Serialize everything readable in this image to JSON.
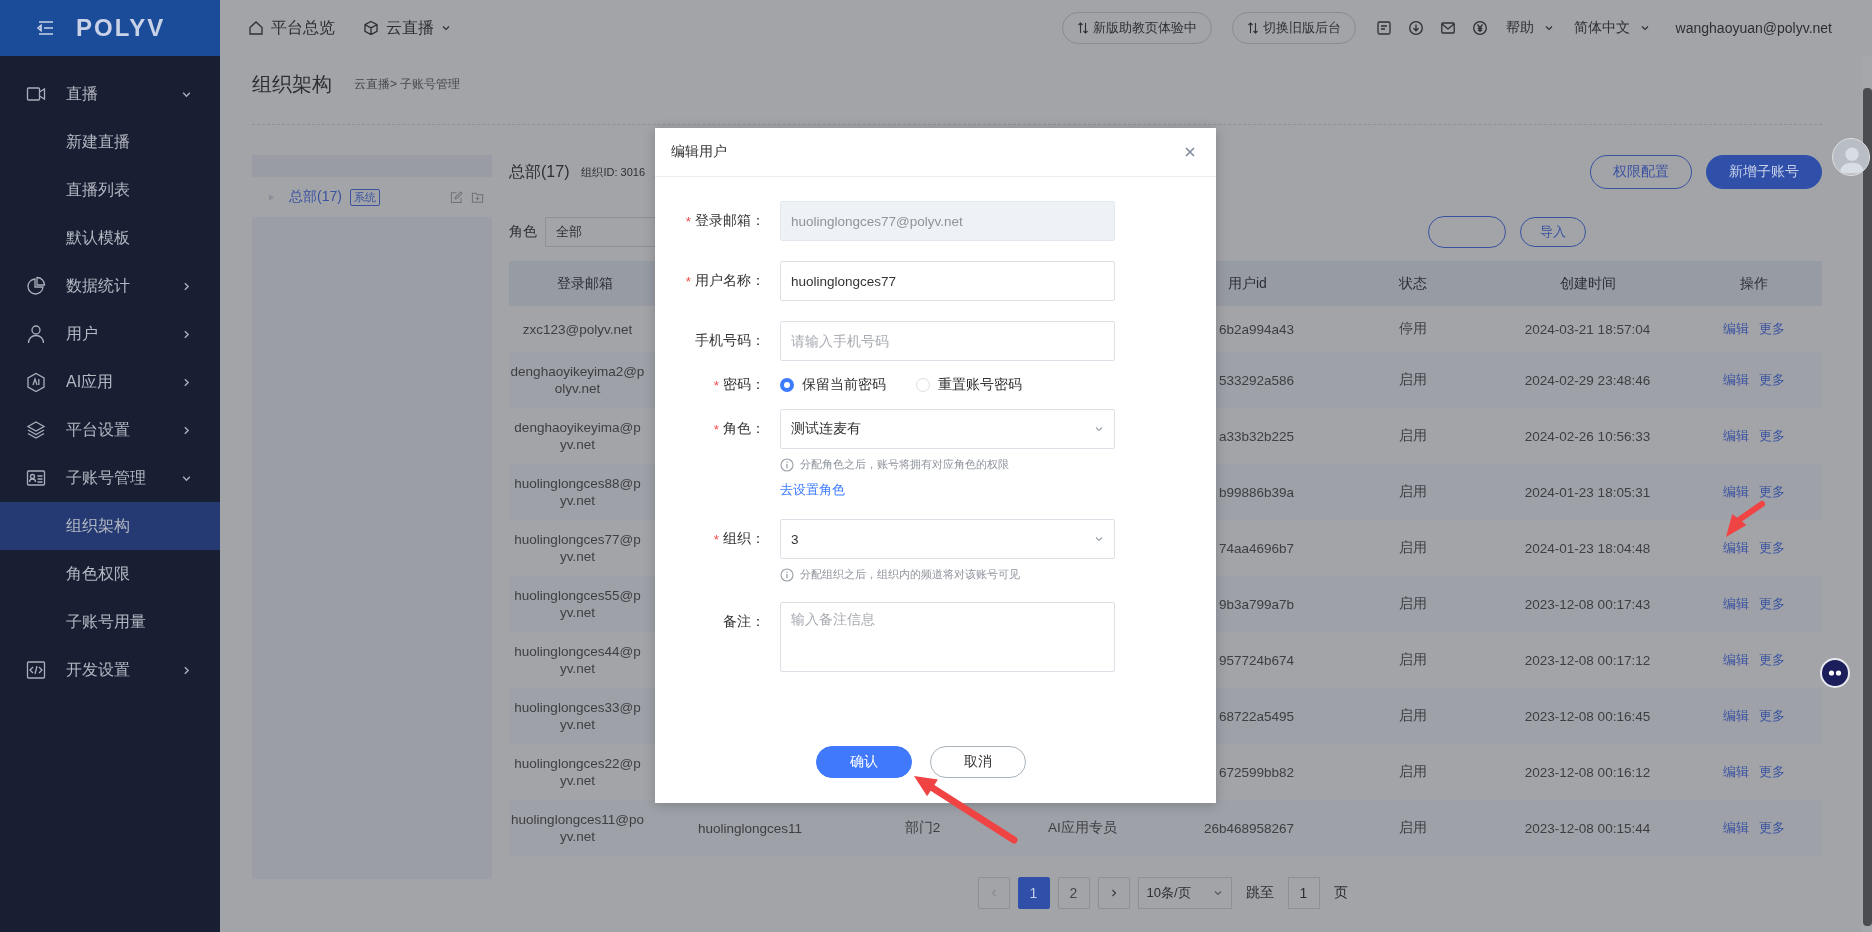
{
  "sidebar": {
    "logo": "POLYV",
    "items": [
      {
        "label": "直播",
        "expanded": true,
        "children": [
          {
            "label": "新建直播",
            "selected": false
          },
          {
            "label": "直播列表",
            "selected": false
          },
          {
            "label": "默认模板",
            "selected": false
          }
        ]
      },
      {
        "label": "数据统计",
        "expanded": false
      },
      {
        "label": "用户",
        "expanded": false
      },
      {
        "label": "AI应用",
        "expanded": false
      },
      {
        "label": "平台设置",
        "expanded": false
      },
      {
        "label": "子账号管理",
        "expanded": true,
        "children": [
          {
            "label": "组织架构",
            "selected": true
          },
          {
            "label": "角色权限",
            "selected": false
          },
          {
            "label": "子账号用量",
            "selected": false
          }
        ]
      },
      {
        "label": "开发设置",
        "expanded": false
      }
    ]
  },
  "topbar": {
    "nav": [
      {
        "label": "平台总览",
        "dropdown": false
      },
      {
        "label": "云直播",
        "dropdown": true
      }
    ],
    "buttons": [
      "新版助教页体验中",
      "切换旧版后台"
    ],
    "menus": [
      {
        "label": "帮助"
      },
      {
        "label": "简体中文"
      }
    ],
    "user": "wanghaoyuan@polyv.net"
  },
  "page": {
    "title": "组织架构",
    "breadcrumb": "云直播> 子账号管理"
  },
  "org_tree": {
    "items": [
      {
        "label": "总部(17)",
        "tag": "系统",
        "selected": true
      }
    ]
  },
  "panel": {
    "title": "总部(17)",
    "org_id": "组织ID: 3016",
    "buttons": [
      {
        "label": "权限配置",
        "primary": false
      },
      {
        "label": "新增子账号",
        "primary": true
      }
    ],
    "filter": {
      "label": "角色",
      "value": "全部"
    },
    "import": "导入"
  },
  "table": {
    "columns": [
      {
        "label": "登录邮箱"
      },
      {},
      {},
      {},
      {
        "label": "用户id"
      },
      {
        "label": "状态"
      },
      {
        "label": "创建时间"
      },
      {
        "label": "操作"
      }
    ],
    "rows": [
      {
        "email": [
          "zxc123@polyv.net"
        ],
        "user_id": "6b2a994a43",
        "status": "停用",
        "created": "2024-03-21 18:57:04",
        "actions": [
          "编辑",
          "更多"
        ]
      },
      {
        "email": [
          "denghaoyikeyima2@p",
          "olyv.net"
        ],
        "user_id": "533292a586",
        "status": "启用",
        "created": "2024-02-29 23:48:46",
        "actions": [
          "编辑",
          "更多"
        ]
      },
      {
        "email": [
          "denghaoyikeyima@p",
          "yv.net"
        ],
        "user_id": "a33b32b225",
        "status": "启用",
        "created": "2024-02-26 10:56:33",
        "actions": [
          "编辑",
          "更多"
        ]
      },
      {
        "email": [
          "huolinglongces88@p",
          "yv.net"
        ],
        "user_id": "b99886b39a",
        "status": "启用",
        "created": "2024-01-23 18:05:31",
        "actions": [
          "编辑",
          "更多"
        ]
      },
      {
        "email": [
          "huolinglongces77@p",
          "yv.net"
        ],
        "user_id": "74aa4696b7",
        "status": "启用",
        "created": "2024-01-23 18:04:48",
        "actions": [
          "编辑",
          "更多"
        ]
      },
      {
        "email": [
          "huolinglongces55@p",
          "yv.net"
        ],
        "user_id": "9b3a799a7b",
        "status": "启用",
        "created": "2023-12-08 00:17:43",
        "actions": [
          "编辑",
          "更多"
        ]
      },
      {
        "email": [
          "huolinglongces44@p",
          "yv.net"
        ],
        "user_id": "957724b674",
        "status": "启用",
        "created": "2023-12-08 00:17:12",
        "actions": [
          "编辑",
          "更多"
        ]
      },
      {
        "email": [
          "huolinglongces33@p",
          "yv.net"
        ],
        "user_id": "68722a5495",
        "status": "启用",
        "created": "2023-12-08 00:16:45",
        "actions": [
          "编辑",
          "更多"
        ]
      },
      {
        "email": [
          "huolinglongces22@p",
          "yv.net"
        ],
        "user_id": "672599bb82",
        "status": "启用",
        "created": "2023-12-08 00:16:12",
        "actions": [
          "编辑",
          "更多"
        ]
      },
      {
        "email": [
          "huolinglongces11@po",
          "yv.net"
        ],
        "column_2": "huolinglongces11",
        "column_3": "部门2",
        "column_4": "AI应用专员",
        "user_id": "26b468958267",
        "status": "启用",
        "created": "2023-12-08 00:15:44",
        "actions": [
          "编辑",
          "更多"
        ]
      }
    ]
  },
  "pagination": {
    "pages": [
      {
        "label": "1",
        "selected": true
      },
      {
        "label": "2",
        "selected": false
      }
    ],
    "page_size": "10条/页",
    "jump_label": "跳至",
    "jump_value": "1",
    "page_unit": "页"
  },
  "dialog": {
    "title": "编辑用户",
    "fields": [
      {
        "kind": "input",
        "mark": "*",
        "label": "登录邮箱：",
        "value": "huolinglongces77@polyv.net",
        "disabled": true
      },
      {
        "kind": "input",
        "mark": "*",
        "label": "用户名称：",
        "value": "huolinglongces77",
        "disabled": false
      },
      {
        "kind": "input",
        "label": "手机号码：",
        "placeholder": "请输入手机号码",
        "disabled": false
      },
      {
        "kind": "radio",
        "mark": "*",
        "label": "密码：",
        "options": [
          {
            "label": "保留当前密码",
            "selected": true
          },
          {
            "label": "重置账号密码",
            "selected": false
          }
        ]
      },
      {
        "kind": "select",
        "mark": "*",
        "label": "角色：",
        "value": "测试连麦有",
        "hint": "分配角色之后，账号将拥有对应角色的权限",
        "link": "去设置角色"
      },
      {
        "kind": "select",
        "mark": "*",
        "label": "组织：",
        "value": "3",
        "hint": "分配组织之后，组织内的频道将对该账号可见"
      },
      {
        "kind": "textarea",
        "label": "备注：",
        "placeholder": "输入备注信息"
      }
    ],
    "buttons": [
      {
        "label": "确认",
        "primary": true
      },
      {
        "label": "取消",
        "primary": false
      }
    ]
  }
}
